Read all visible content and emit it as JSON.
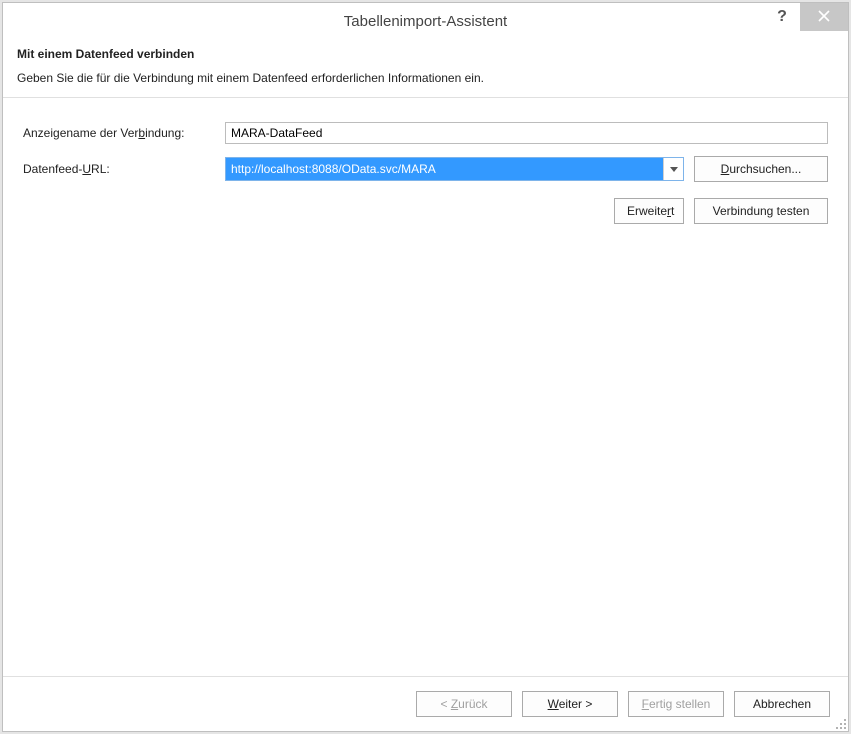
{
  "window": {
    "title": "Tabellenimport-Assistent"
  },
  "header": {
    "heading": "Mit einem Datenfeed verbinden",
    "description": "Geben Sie die für die Verbindung mit einem Datenfeed erforderlichen Informationen ein."
  },
  "form": {
    "connection_name_label_pre": "Anzeigename der Ver",
    "connection_name_label_ul": "b",
    "connection_name_label_post": "indung:",
    "connection_name_value": "MARA-DataFeed",
    "url_label_pre": "Datenfeed-",
    "url_label_ul": "U",
    "url_label_post": "RL:",
    "url_value": "http://localhost:8088/OData.svc/MARA",
    "browse_pre": "",
    "browse_ul": "D",
    "browse_post": "urchsuchen...",
    "advanced_pre": "Erweite",
    "advanced_ul": "r",
    "advanced_post": "t",
    "test_label": "Verbindung testen"
  },
  "footer": {
    "back_pre": "< ",
    "back_ul": "Z",
    "back_post": "urück",
    "next_pre": "",
    "next_ul": "W",
    "next_post": "eiter >",
    "finish_pre": "",
    "finish_ul": "F",
    "finish_post": "ertig stellen",
    "cancel_label": "Abbrechen"
  }
}
